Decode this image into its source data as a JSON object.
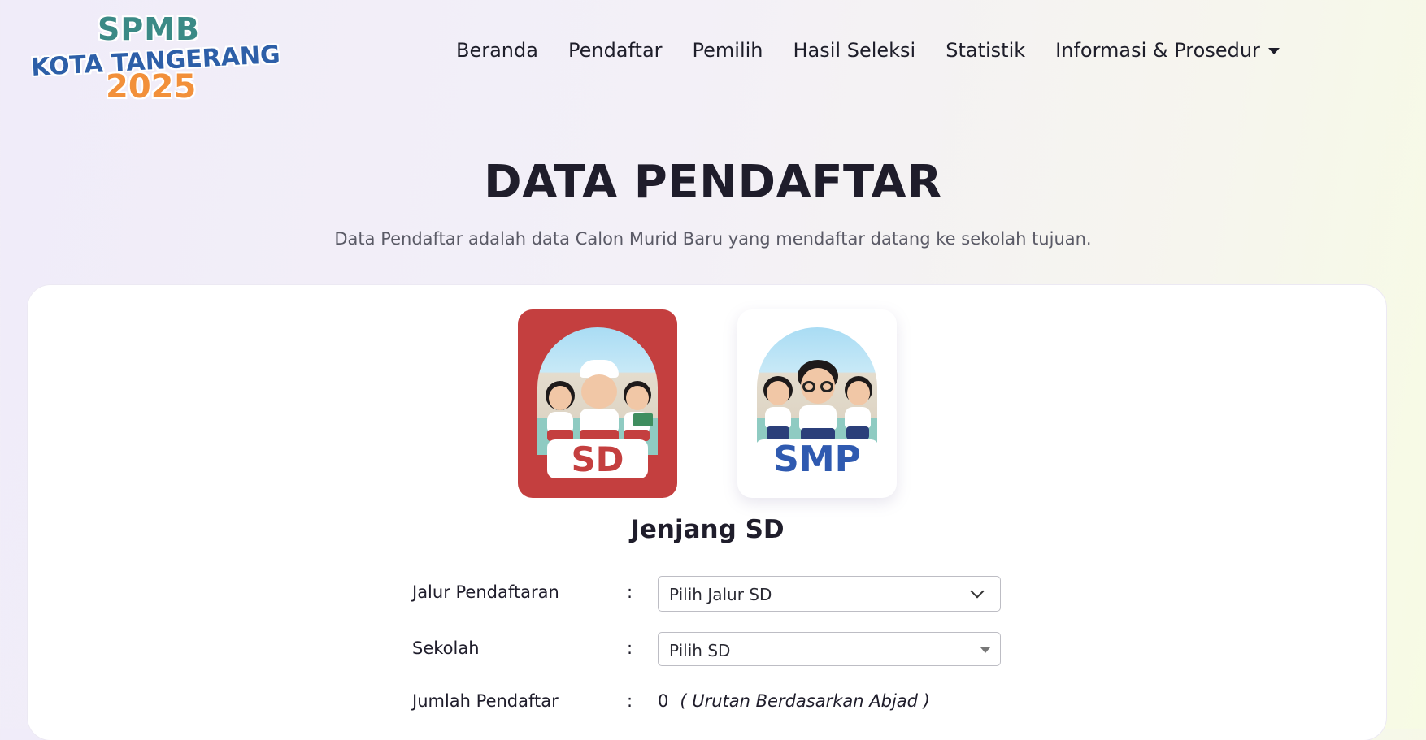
{
  "logo": {
    "line1": "SPMB",
    "line2": "KOTA TANGERANG",
    "line3": "2025"
  },
  "nav": {
    "items": [
      "Beranda",
      "Pendaftar",
      "Pemilih",
      "Hasil Seleksi",
      "Statistik"
    ],
    "dropdown_label": "Informasi & Prosedur"
  },
  "page": {
    "title": "DATA PENDAFTAR",
    "subtitle": "Data Pendaftar adalah data Calon Murid Baru yang mendaftar datang ke sekolah tujuan."
  },
  "levels": [
    {
      "label": "SD",
      "selected": true,
      "color": "#c43f3f"
    },
    {
      "label": "SMP",
      "selected": false,
      "color": "#2f5ab0"
    }
  ],
  "selected_level_label": "Jenjang SD",
  "form": {
    "jalur_label": "Jalur Pendaftaran",
    "jalur_value": "Pilih Jalur SD",
    "sekolah_label": "Sekolah",
    "sekolah_value": "Pilih SD",
    "jumlah_label": "Jumlah Pendaftar",
    "jumlah_value": "0",
    "jumlah_note": "( Urutan Berdasarkan Abjad )",
    "colon": ":"
  },
  "colors": {
    "accent_red": "#c43f3f",
    "accent_blue": "#2f5ab0",
    "logo_teal": "#3b8a86",
    "logo_orange": "#f2903a"
  }
}
